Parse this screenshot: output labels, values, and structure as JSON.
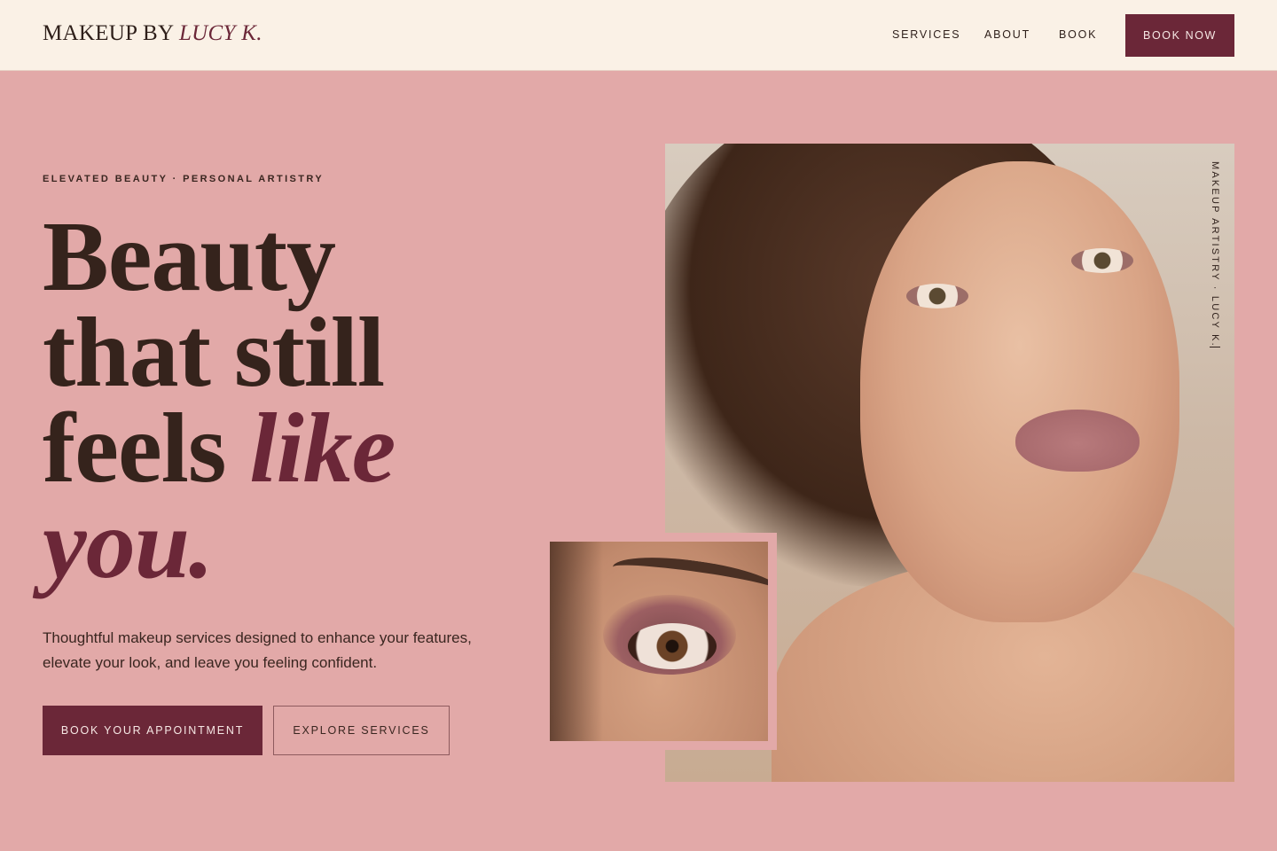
{
  "brand": {
    "prefix": "MAKEUP BY",
    "name": "LUCY K."
  },
  "nav": {
    "services": "SERVICES",
    "about": "ABOUT",
    "book": "BOOK",
    "cta": "BOOK NOW"
  },
  "hero": {
    "eyebrow": "ELEVATED BEAUTY · PERSONAL ARTISTRY",
    "headline": {
      "line1": "Beauty",
      "line2": "that still",
      "line3_plain": "feels ",
      "line3_accent": "like",
      "line4_accent": "you."
    },
    "subtext": "Thoughtful makeup services designed to enhance your features, elevate your look, and leave you feeling confident.",
    "primary_button": "BOOK YOUR APPOINTMENT",
    "secondary_button": "EXPLORE SERVICES"
  },
  "images": {
    "portrait_caption": "MAKEUP ARTISTRY · LUCY K."
  },
  "colors": {
    "accent": "#6b2738",
    "background": "#e2a9a8",
    "header": "#faf1e6",
    "text": "#35231c"
  }
}
